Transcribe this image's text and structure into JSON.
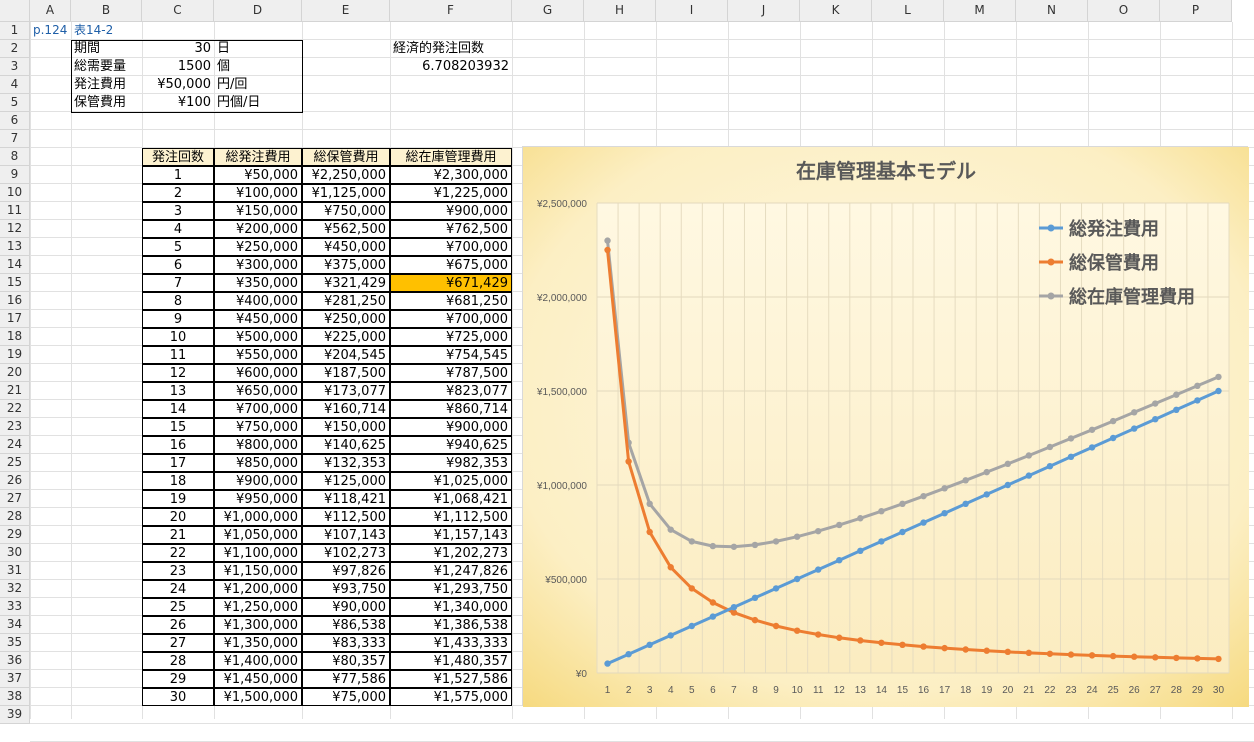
{
  "columns": [
    "A",
    "B",
    "C",
    "D",
    "E",
    "F",
    "G",
    "H",
    "I",
    "J",
    "K",
    "L",
    "M",
    "N",
    "O",
    "P"
  ],
  "rows": [
    "1",
    "2",
    "3",
    "4",
    "5",
    "6",
    "7",
    "8",
    "9",
    "10",
    "11",
    "12",
    "13",
    "14",
    "15",
    "16",
    "17",
    "18",
    "19",
    "20",
    "21",
    "22",
    "23",
    "24",
    "25",
    "26",
    "27",
    "28",
    "29",
    "30",
    "31",
    "32",
    "33",
    "34",
    "35",
    "36",
    "37",
    "38",
    "39"
  ],
  "ref": {
    "page": "p.124",
    "table": "表14-2"
  },
  "params": [
    {
      "label": "期間",
      "value": "30",
      "unit": "日"
    },
    {
      "label": "総需要量",
      "value": "1500",
      "unit": "個"
    },
    {
      "label": "発注費用",
      "value": "¥50,000",
      "unit": "円/回"
    },
    {
      "label": "保管費用",
      "value": "¥100",
      "unit": "円個/日"
    }
  ],
  "eoq": {
    "label": "経済的発注回数",
    "value": "6.708203932"
  },
  "table": {
    "headers": [
      "発注回数",
      "総発注費用",
      "総保管費用",
      "総在庫管理費用"
    ],
    "highlight_row": 6,
    "highlight_color": "#ffc000",
    "header_fill": "#fdf2d0",
    "rows": [
      [
        "1",
        "¥50,000",
        "¥2,250,000",
        "¥2,300,000"
      ],
      [
        "2",
        "¥100,000",
        "¥1,125,000",
        "¥1,225,000"
      ],
      [
        "3",
        "¥150,000",
        "¥750,000",
        "¥900,000"
      ],
      [
        "4",
        "¥200,000",
        "¥562,500",
        "¥762,500"
      ],
      [
        "5",
        "¥250,000",
        "¥450,000",
        "¥700,000"
      ],
      [
        "6",
        "¥300,000",
        "¥375,000",
        "¥675,000"
      ],
      [
        "7",
        "¥350,000",
        "¥321,429",
        "¥671,429"
      ],
      [
        "8",
        "¥400,000",
        "¥281,250",
        "¥681,250"
      ],
      [
        "9",
        "¥450,000",
        "¥250,000",
        "¥700,000"
      ],
      [
        "10",
        "¥500,000",
        "¥225,000",
        "¥725,000"
      ],
      [
        "11",
        "¥550,000",
        "¥204,545",
        "¥754,545"
      ],
      [
        "12",
        "¥600,000",
        "¥187,500",
        "¥787,500"
      ],
      [
        "13",
        "¥650,000",
        "¥173,077",
        "¥823,077"
      ],
      [
        "14",
        "¥700,000",
        "¥160,714",
        "¥860,714"
      ],
      [
        "15",
        "¥750,000",
        "¥150,000",
        "¥900,000"
      ],
      [
        "16",
        "¥800,000",
        "¥140,625",
        "¥940,625"
      ],
      [
        "17",
        "¥850,000",
        "¥132,353",
        "¥982,353"
      ],
      [
        "18",
        "¥900,000",
        "¥125,000",
        "¥1,025,000"
      ],
      [
        "19",
        "¥950,000",
        "¥118,421",
        "¥1,068,421"
      ],
      [
        "20",
        "¥1,000,000",
        "¥112,500",
        "¥1,112,500"
      ],
      [
        "21",
        "¥1,050,000",
        "¥107,143",
        "¥1,157,143"
      ],
      [
        "22",
        "¥1,100,000",
        "¥102,273",
        "¥1,202,273"
      ],
      [
        "23",
        "¥1,150,000",
        "¥97,826",
        "¥1,247,826"
      ],
      [
        "24",
        "¥1,200,000",
        "¥93,750",
        "¥1,293,750"
      ],
      [
        "25",
        "¥1,250,000",
        "¥90,000",
        "¥1,340,000"
      ],
      [
        "26",
        "¥1,300,000",
        "¥86,538",
        "¥1,386,538"
      ],
      [
        "27",
        "¥1,350,000",
        "¥83,333",
        "¥1,433,333"
      ],
      [
        "28",
        "¥1,400,000",
        "¥80,357",
        "¥1,480,357"
      ],
      [
        "29",
        "¥1,450,000",
        "¥77,586",
        "¥1,527,586"
      ],
      [
        "30",
        "¥1,500,000",
        "¥75,000",
        "¥1,575,000"
      ]
    ]
  },
  "chart_data": {
    "type": "line",
    "title": "在庫管理基本モデル",
    "xlabel": "",
    "ylabel": "",
    "x": [
      1,
      2,
      3,
      4,
      5,
      6,
      7,
      8,
      9,
      10,
      11,
      12,
      13,
      14,
      15,
      16,
      17,
      18,
      19,
      20,
      21,
      22,
      23,
      24,
      25,
      26,
      27,
      28,
      29,
      30
    ],
    "ylim": [
      0,
      2500000
    ],
    "yticks": [
      "¥0",
      "¥500,000",
      "¥1,000,000",
      "¥1,500,000",
      "¥2,000,000",
      "¥2,500,000"
    ],
    "ytick_values": [
      0,
      500000,
      1000000,
      1500000,
      2000000,
      2500000
    ],
    "grid": true,
    "legend": "top-right",
    "series": [
      {
        "name": "総発注費用",
        "color": "#5b9bd5",
        "values": [
          50000,
          100000,
          150000,
          200000,
          250000,
          300000,
          350000,
          400000,
          450000,
          500000,
          550000,
          600000,
          650000,
          700000,
          750000,
          800000,
          850000,
          900000,
          950000,
          1000000,
          1050000,
          1100000,
          1150000,
          1200000,
          1250000,
          1300000,
          1350000,
          1400000,
          1450000,
          1500000
        ]
      },
      {
        "name": "総保管費用",
        "color": "#ed7d31",
        "values": [
          2250000,
          1125000,
          750000,
          562500,
          450000,
          375000,
          321429,
          281250,
          250000,
          225000,
          204545,
          187500,
          173077,
          160714,
          150000,
          140625,
          132353,
          125000,
          118421,
          112500,
          107143,
          102273,
          97826,
          93750,
          90000,
          86538,
          83333,
          80357,
          77586,
          75000
        ]
      },
      {
        "name": "総在庫管理費用",
        "color": "#a5a5a5",
        "values": [
          2300000,
          1225000,
          900000,
          762500,
          700000,
          675000,
          671429,
          681250,
          700000,
          725000,
          754545,
          787500,
          823077,
          860714,
          900000,
          940625,
          982353,
          1025000,
          1068421,
          1112500,
          1157143,
          1202273,
          1247826,
          1293750,
          1340000,
          1386538,
          1433333,
          1480357,
          1527586,
          1575000
        ]
      }
    ]
  }
}
